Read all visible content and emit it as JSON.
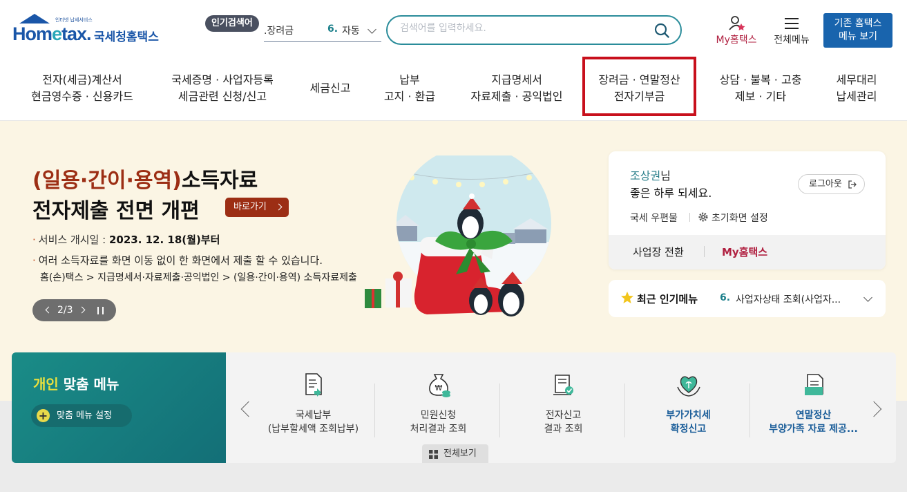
{
  "header": {
    "logo_tagline": "인터넷 납세서비스",
    "logo_word_a": "Hom",
    "logo_word_e": "e",
    "logo_word_b": "tax.",
    "logo_korean": "국세청홈택스",
    "popular_tag": "인기검색어",
    "popular_prefix": ".장려금",
    "popular_rank": "6.",
    "popular_term": "자동",
    "search_placeholder": "검색어를 입력하세요.",
    "my_hometax": "My홈택스",
    "all_menu": "전체메뉴",
    "legacy_line1": "기존 홈택스",
    "legacy_line2": "메뉴 보기"
  },
  "nav": {
    "items": [
      {
        "line1": "전자(세금)계산서",
        "line2": "현금영수증 · 신용카드"
      },
      {
        "line1": "국세증명 · 사업자등록",
        "line2": "세금관련 신청/신고"
      },
      {
        "line1": "세금신고",
        "line2": ""
      },
      {
        "line1": "납부",
        "line2": "고지 · 환급"
      },
      {
        "line1": "지급명세서",
        "line2": "자료제출 · 공익법인"
      },
      {
        "line1": "장려금 · 연말정산",
        "line2": "전자기부금"
      },
      {
        "line1": "상담 · 불복 · 고충",
        "line2": "제보 · 기타"
      },
      {
        "line1": "세무대리",
        "line2": "납세관리"
      }
    ],
    "highlight_color": "#c8101c"
  },
  "banner": {
    "title_red": "(일용·간이·용역)",
    "title_rest": "소득자료",
    "title_line2": "전자제출 전면 개편",
    "go_button": "바로가기",
    "line1_label": "서비스 개시일 : ",
    "line1_value": "2023. 12. 18(월)부터",
    "line2": "여러 소득자료를 화면 이동 없이 한 화면에서 제출 할 수 있습니다.",
    "line3": "홈(손)택스 > 지급명세서·자료제출·공익법인 > (일용·간이·용역) 소득자료제출",
    "pager": "2/3",
    "background_color": "#fbf5e4"
  },
  "user": {
    "name": "조상권",
    "name_suffix": "님",
    "greeting": "좋은 하루 되세요.",
    "logout": "로그아웃",
    "post": "국세 우편물",
    "init": "초기화면 설정",
    "switch": "사업장 전환",
    "my": "My홈택스"
  },
  "recent": {
    "label": "최근 인기메뉴",
    "rank": "6.",
    "value": "사업자상태 조회(사업자..."
  },
  "personal": {
    "title_yellow": "개인",
    "title_rest": " 맞춤 메뉴",
    "setting": "맞춤 메뉴 설정",
    "view_all": "전체보기",
    "items": [
      {
        "icon": "tax-payment-icon",
        "line1": "국세납부",
        "line2": "(납부할세액 조회납부)"
      },
      {
        "icon": "civil-petition-icon",
        "line1": "민원신청",
        "line2": "처리결과 조회"
      },
      {
        "icon": "electronic-filing-icon",
        "line1": "전자신고",
        "line2": "결과 조회"
      },
      {
        "icon": "vat-icon",
        "line1": "부가가치세",
        "line2": "확정신고"
      },
      {
        "icon": "year-end-settlement-icon",
        "line1": "연말정산",
        "line2": "부양가족 자료 제공..."
      }
    ],
    "accent_color": "#1a8c87"
  }
}
